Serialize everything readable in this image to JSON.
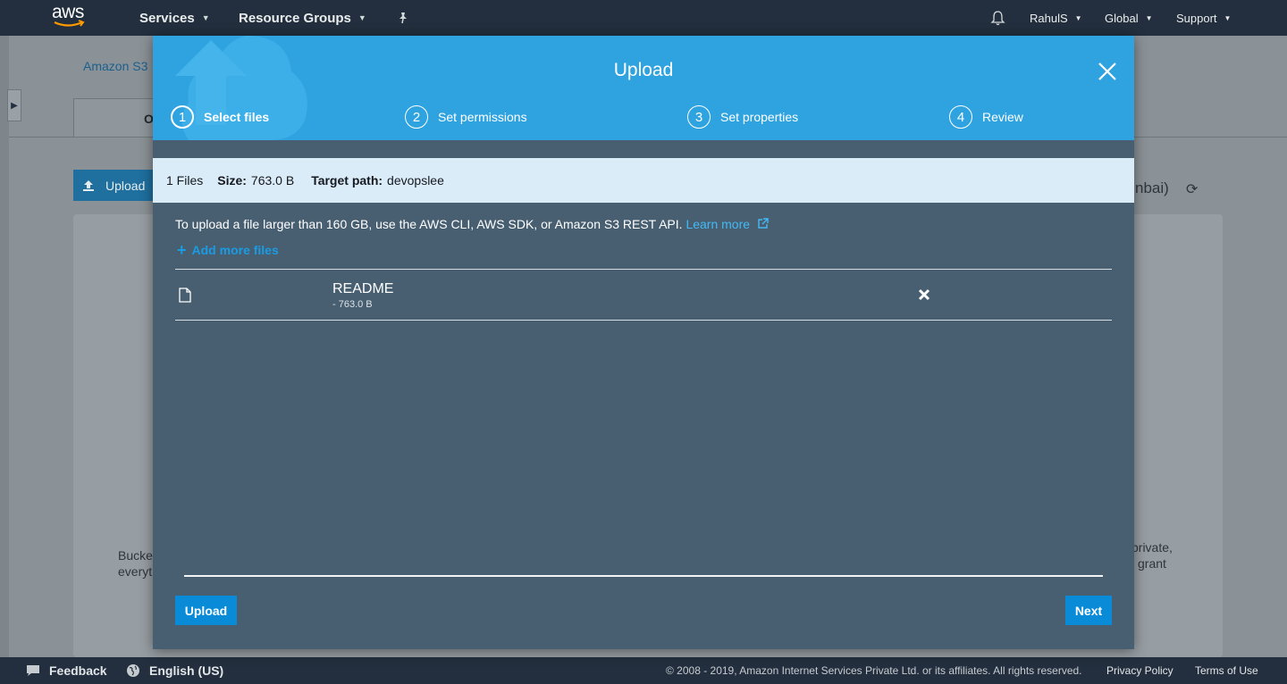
{
  "topnav": {
    "logo_text": "aws",
    "services": "Services",
    "resource_groups": "Resource Groups",
    "user": "RahulS",
    "region": "Global",
    "support": "Support",
    "icons": [
      "pin-icon",
      "bell-icon"
    ]
  },
  "background": {
    "breadcrumb": "Amazon S3",
    "tab_initial": "O",
    "upload_button": "Upload",
    "region_fragment": "nbai)",
    "left_text": [
      "Bucke",
      "everyt"
    ],
    "right_text": [
      "private,",
      "grant"
    ]
  },
  "modal": {
    "title": "Upload",
    "steps": [
      {
        "num": "1",
        "label": "Select files",
        "active": true
      },
      {
        "num": "2",
        "label": "Set permissions",
        "active": false
      },
      {
        "num": "3",
        "label": "Set properties",
        "active": false
      },
      {
        "num": "4",
        "label": "Review",
        "active": false
      }
    ],
    "summary": {
      "files": "1 Files",
      "size_label": "Size:",
      "size_value": "763.0 B",
      "target_label": "Target path:",
      "target_value": "devopslee"
    },
    "notice": "To upload a file larger than 160 GB, use the AWS CLI, AWS SDK, or Amazon S3 REST API.",
    "learn_more": "Learn more",
    "add_more_files": "Add more files",
    "files": [
      {
        "name": "README",
        "size": "- 763.0 B"
      }
    ],
    "upload_button": "Upload",
    "next_button": "Next"
  },
  "footer": {
    "feedback": "Feedback",
    "language": "English (US)",
    "copyright": "© 2008 - 2019, Amazon Internet Services Private Ltd. or its affiliates. All rights reserved.",
    "privacy": "Privacy Policy",
    "terms": "Terms of Use"
  },
  "colors": {
    "nav_bg": "#232f3e",
    "modal_header": "#2fa3e0",
    "modal_body": "#485f72",
    "summary_bg": "#daecf8",
    "button_primary": "#0a8bd8",
    "link": "#44b9f6"
  }
}
